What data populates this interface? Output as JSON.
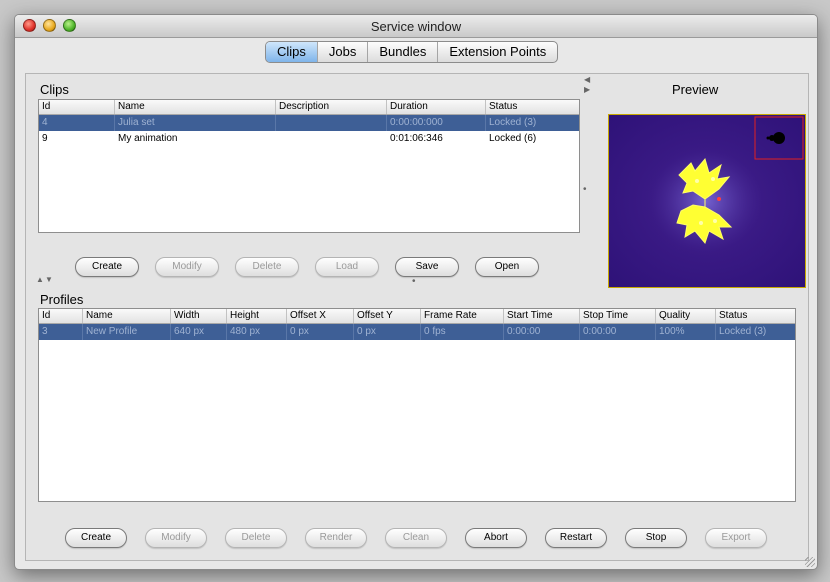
{
  "window": {
    "title": "Service window"
  },
  "tabs": [
    "Clips",
    "Jobs",
    "Bundles",
    "Extension Points"
  ],
  "clips": {
    "title": "Clips",
    "columns": [
      "Id",
      "Name",
      "Description",
      "Duration",
      "Status"
    ],
    "rows": [
      [
        "4",
        "Julia set",
        "",
        "0:00:00:000",
        "Locked (3)"
      ],
      [
        "9",
        "My animation",
        "",
        "0:01:06:346",
        "Locked (6)"
      ]
    ],
    "buttons": [
      "Create",
      "Modify",
      "Delete",
      "Load",
      "Save",
      "Open"
    ]
  },
  "preview": {
    "title": "Preview"
  },
  "profiles": {
    "title": "Profiles",
    "columns": [
      "Id",
      "Name",
      "Width",
      "Height",
      "Offset X",
      "Offset Y",
      "Frame Rate",
      "Start Time",
      "Stop Time",
      "Quality",
      "Status"
    ],
    "rows": [
      [
        "3",
        "New Profile",
        "640 px",
        "480 px",
        "0 px",
        "0 px",
        "0 fps",
        "0:00:00",
        "0:00:00",
        "100%",
        "Locked (3)"
      ]
    ],
    "buttons": [
      "Create",
      "Modify",
      "Delete",
      "Render",
      "Clean",
      "Abort",
      "Restart",
      "Stop",
      "Export"
    ]
  },
  "colors": {
    "selection": "#3e5f96",
    "tab_active": "#7fb4ea",
    "preview_bg": "#3a1a85",
    "fractal": "#ffff33"
  }
}
